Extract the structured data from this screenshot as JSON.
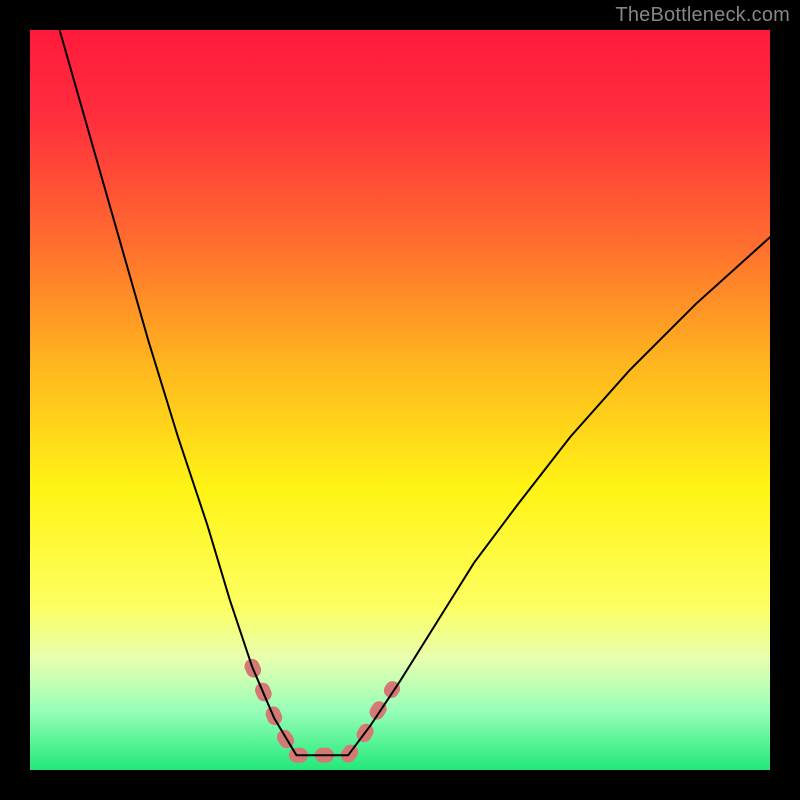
{
  "watermark": "TheBottleneck.com",
  "chart_data": {
    "type": "line",
    "title": "",
    "xlabel": "",
    "ylabel": "",
    "xlim": [
      0,
      100
    ],
    "ylim": [
      0,
      100
    ],
    "grid": false,
    "gradient_stops": [
      {
        "offset": 0,
        "color": "#ff1a3c"
      },
      {
        "offset": 12,
        "color": "#ff2f3d"
      },
      {
        "offset": 28,
        "color": "#ff6a2f"
      },
      {
        "offset": 45,
        "color": "#ffb51f"
      },
      {
        "offset": 62,
        "color": "#fff415"
      },
      {
        "offset": 78,
        "color": "#fdff62"
      },
      {
        "offset": 85,
        "color": "#e7ffb0"
      },
      {
        "offset": 92,
        "color": "#97ffb8"
      },
      {
        "offset": 100,
        "color": "#22e87a"
      }
    ],
    "series": [
      {
        "name": "curve-left",
        "stroke": "#000000",
        "x": [
          4,
          8,
          12,
          16,
          20,
          24,
          27,
          30,
          33,
          36
        ],
        "y": [
          100,
          86,
          72,
          58,
          45,
          33,
          23,
          14,
          7,
          2
        ]
      },
      {
        "name": "curve-right",
        "stroke": "#000000",
        "x": [
          43,
          46,
          50,
          55,
          60,
          66,
          73,
          81,
          90,
          100
        ],
        "y": [
          2,
          6,
          12,
          20,
          28,
          36,
          45,
          54,
          63,
          72
        ]
      }
    ],
    "flat_segment": {
      "name": "valley-flat",
      "stroke": "#000000",
      "x": [
        36,
        43
      ],
      "y": [
        2,
        2
      ]
    },
    "highlight_bands": [
      {
        "name": "valley-highlight-left",
        "color": "#d47a74",
        "x": [
          30,
          32,
          34,
          36
        ],
        "y": [
          14,
          9.5,
          5,
          2
        ]
      },
      {
        "name": "valley-highlight-flat",
        "color": "#d47a74",
        "x": [
          36,
          39,
          41,
          43
        ],
        "y": [
          2,
          2,
          2,
          2
        ]
      },
      {
        "name": "valley-highlight-right",
        "color": "#d47a74",
        "x": [
          43,
          45,
          47,
          49
        ],
        "y": [
          2,
          4.5,
          8,
          11
        ]
      }
    ]
  }
}
